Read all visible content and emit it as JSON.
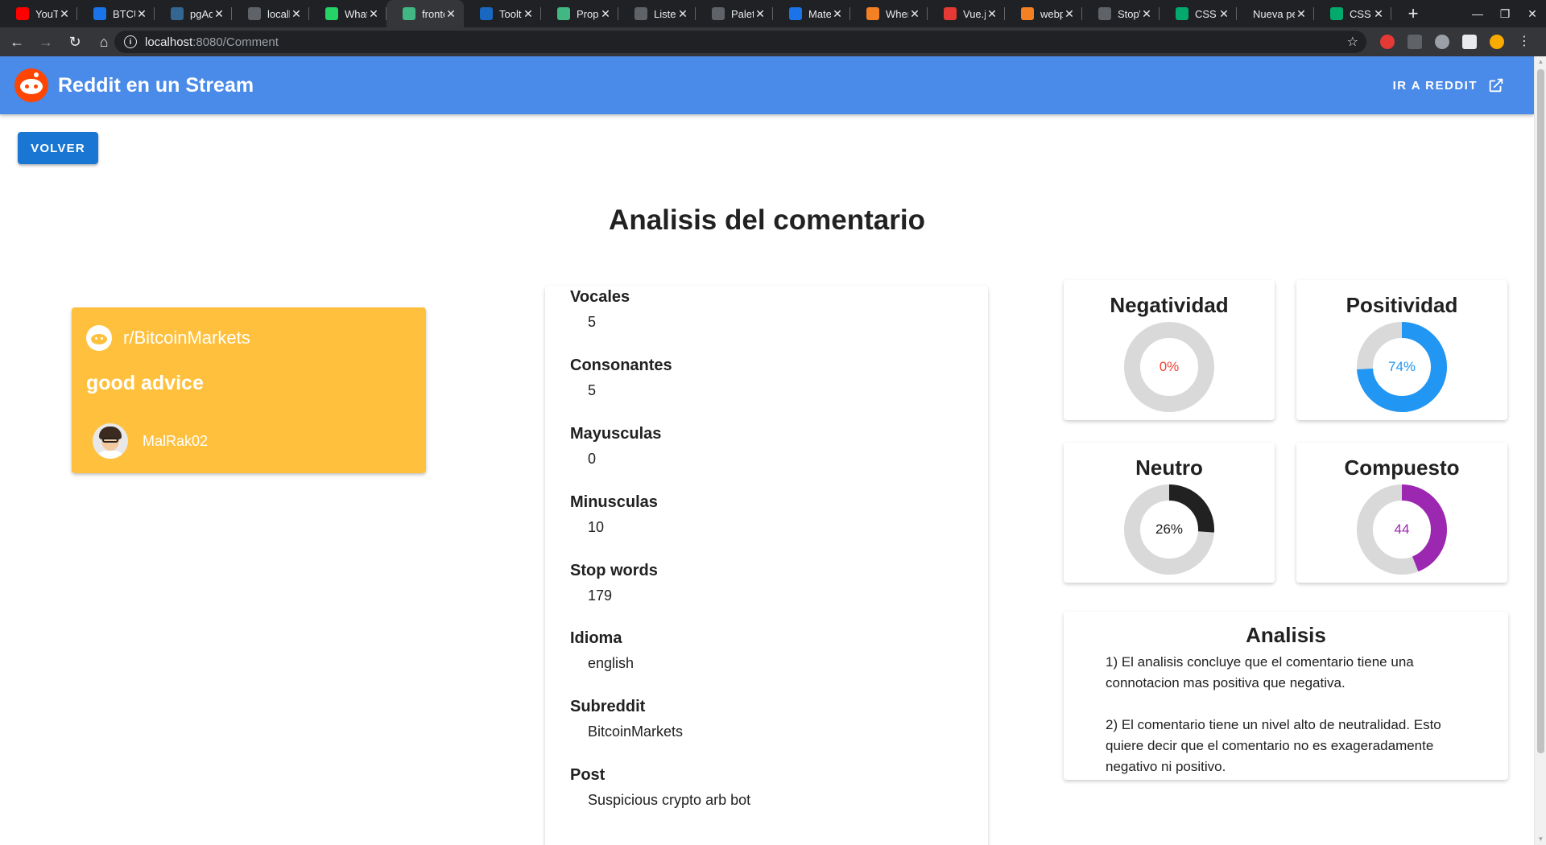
{
  "browser": {
    "tabs": [
      {
        "title": "YouTube",
        "icon": "youtube-icon",
        "color": "#ff0000"
      },
      {
        "title": "BTCU",
        "icon": "chart-icon",
        "color": "#1a73e8"
      },
      {
        "title": "pgAdmin",
        "icon": "pgadmin-icon",
        "color": "#336791"
      },
      {
        "title": "localhost",
        "icon": "globe-icon",
        "color": "#5f6368"
      },
      {
        "title": "WhatsApp",
        "icon": "whatsapp-icon",
        "color": "#25d366"
      },
      {
        "title": "frontend",
        "icon": "vue-icon",
        "color": "#41b883",
        "active": true
      },
      {
        "title": "Tooltip",
        "icon": "vuetify-icon",
        "color": "#1867c0"
      },
      {
        "title": "Props",
        "icon": "vue-icon",
        "color": "#41b883"
      },
      {
        "title": "Listen",
        "icon": "globe-icon",
        "color": "#5f6368"
      },
      {
        "title": "Palette",
        "icon": "palette-icon",
        "color": "#5f6368"
      },
      {
        "title": "Material",
        "icon": "material-icon",
        "color": "#1a73e8"
      },
      {
        "title": "When",
        "icon": "stackoverflow-icon",
        "color": "#f48024"
      },
      {
        "title": "Vue.js",
        "icon": "tp-icon",
        "color": "#e53935"
      },
      {
        "title": "webpack",
        "icon": "stackoverflow-icon",
        "color": "#f48024"
      },
      {
        "title": "StopW",
        "icon": "globe-icon",
        "color": "#5f6368"
      },
      {
        "title": "CSS F",
        "icon": "w3-icon",
        "color": "#04aa6d"
      },
      {
        "title": "Nueva pe",
        "icon": "",
        "color": ""
      },
      {
        "title": "CSS T",
        "icon": "w3-icon",
        "color": "#04aa6d"
      }
    ],
    "url_host": "localhost",
    "url_path": ":8080/Comment"
  },
  "app": {
    "brand": "Reddit en un Stream",
    "goto_label": "IR A REDDIT",
    "back_label": "VOLVER",
    "page_title": "Analisis del comentario"
  },
  "comment": {
    "subreddit": "r/BitcoinMarkets",
    "text": "good advice",
    "author": "MalRak02"
  },
  "stats": [
    {
      "label": "Vocales",
      "value": "5"
    },
    {
      "label": "Consonantes",
      "value": "5"
    },
    {
      "label": "Mayusculas",
      "value": "0"
    },
    {
      "label": "Minusculas",
      "value": "10"
    },
    {
      "label": "Stop words",
      "value": "179"
    },
    {
      "label": "Idioma",
      "value": "english"
    },
    {
      "label": "Subreddit",
      "value": "BitcoinMarkets"
    },
    {
      "label": "Post",
      "value": "Suspicious crypto arb bot"
    }
  ],
  "gauges": [
    {
      "label": "Negatividad",
      "display": "0%",
      "value": 0,
      "color": "#f44336"
    },
    {
      "label": "Positividad",
      "display": "74%",
      "value": 74,
      "color": "#2196f3"
    },
    {
      "label": "Neutro",
      "display": "26%",
      "value": 26,
      "color": "#212121"
    },
    {
      "label": "Compuesto",
      "display": "44",
      "value": 44,
      "color": "#9c27b0"
    }
  ],
  "analysis": {
    "title": "Analisis",
    "paragraphs": [
      "1) El analisis concluye que el comentario tiene una connotacion mas positiva que negativa.",
      "2) El comentario tiene un nivel alto de neutralidad. Esto quiere decir que el comentario no es exageradamente negativo ni positivo."
    ]
  },
  "colors": {
    "appbar": "#4a8ae8",
    "primary_button": "#1976d2",
    "comment_card": "#ffc13d",
    "track": "#d9d9d9"
  }
}
